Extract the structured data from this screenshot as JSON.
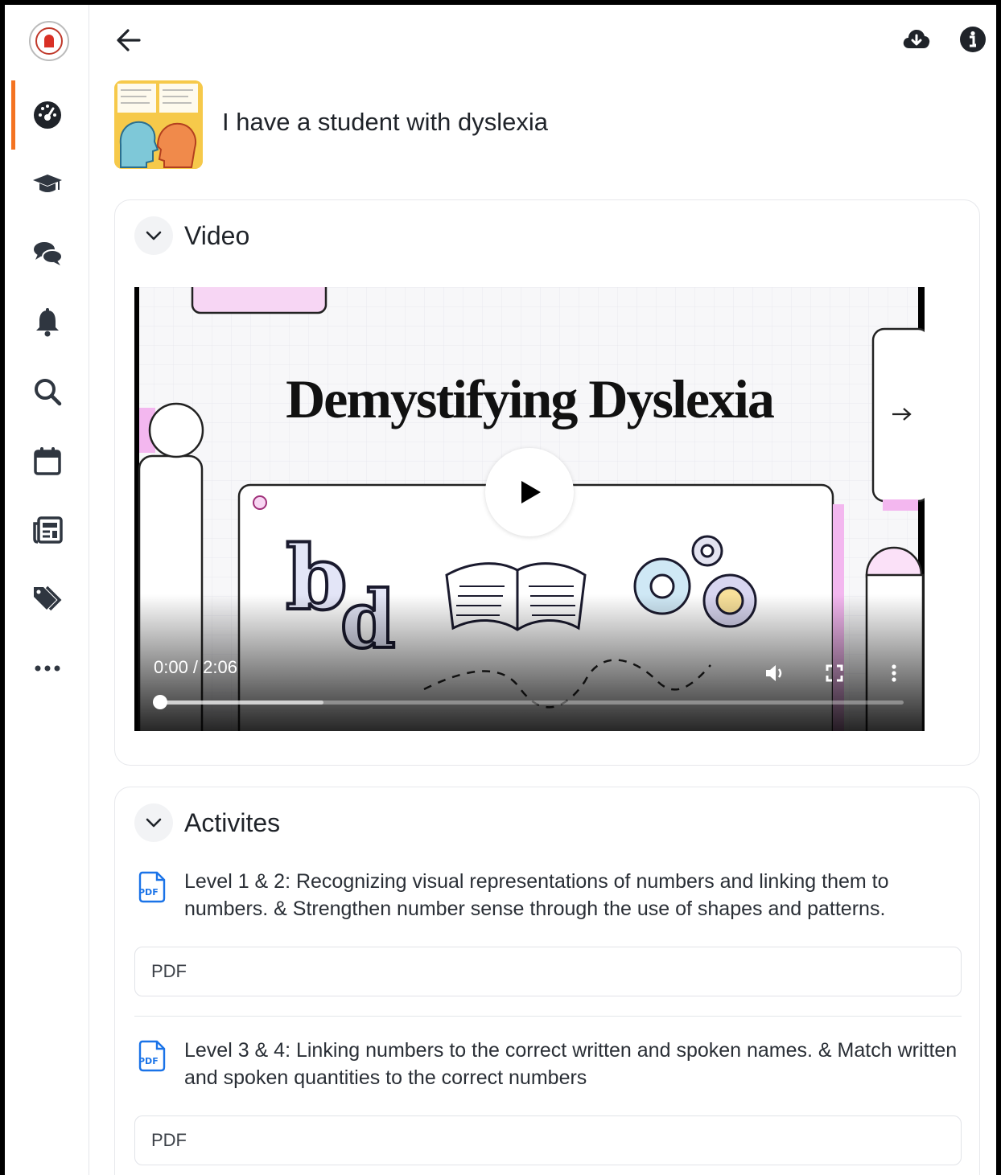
{
  "sidebar": {
    "logo_icon": "university-seal-logo",
    "items": [
      {
        "icon": "dashboard-icon",
        "active": true
      },
      {
        "icon": "graduation-cap-icon",
        "active": false
      },
      {
        "icon": "chat-bubbles-icon",
        "active": false
      },
      {
        "icon": "bell-icon",
        "active": false
      },
      {
        "icon": "search-icon",
        "active": false
      },
      {
        "icon": "calendar-icon",
        "active": false
      },
      {
        "icon": "newspaper-icon",
        "active": false
      },
      {
        "icon": "tags-icon",
        "active": false
      },
      {
        "icon": "more-dots-icon",
        "active": false
      }
    ]
  },
  "topbar": {
    "back_icon": "arrow-left-icon",
    "download_icon": "cloud-download-icon",
    "info_icon": "info-icon"
  },
  "course": {
    "title": "I have a student with dyslexia"
  },
  "video_section": {
    "title": "Video",
    "video_title": "Demystifying Dyslexia",
    "current_time": "0:00",
    "duration": "2:06",
    "time_display": "0:00 / 2:06",
    "progress": 0.0,
    "buffered": 0.22
  },
  "activities_section": {
    "title": "Activites",
    "items": [
      {
        "text": "Level 1 & 2: Recognizing visual representations of numbers and linking them to numbers. & Strengthen number sense through the use of shapes and patterns.",
        "file_label": "PDF"
      },
      {
        "text": "Level 3 & 4: Linking numbers to the correct written and spoken names. & Match written and spoken quantities to the correct numbers",
        "file_label": "PDF"
      }
    ]
  },
  "colors": {
    "accent": "#f47321",
    "text": "#1f2329",
    "pdf_icon": "#1a73e8"
  }
}
